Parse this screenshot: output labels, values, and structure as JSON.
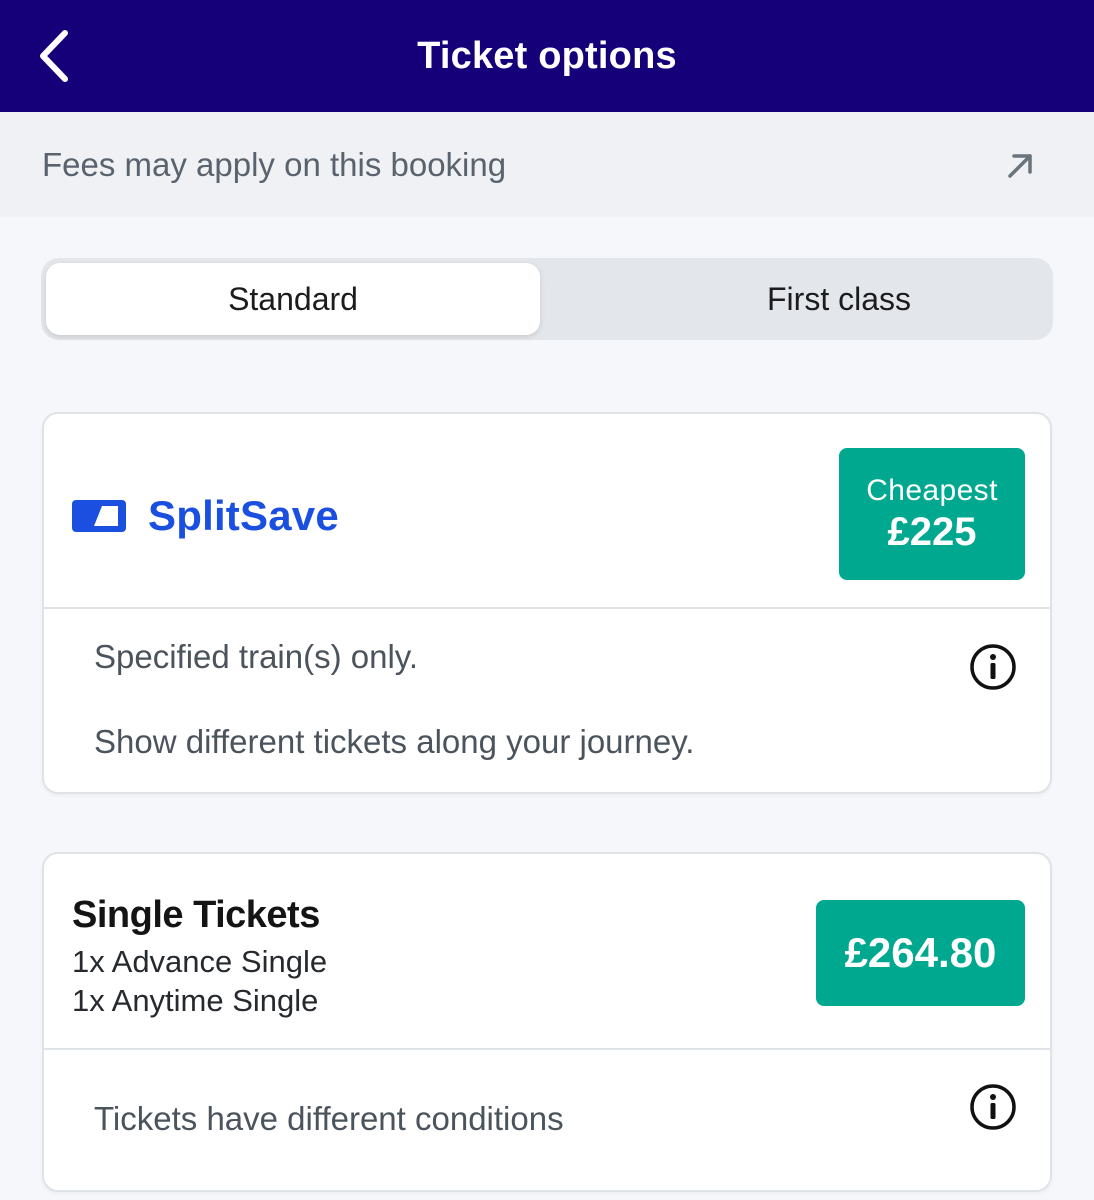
{
  "header": {
    "title": "Ticket options",
    "back_icon": "chevron-left-icon"
  },
  "fees_bar": {
    "text": "Fees may apply on this booking",
    "icon": "arrow-up-right-icon"
  },
  "class_toggle": {
    "options": [
      {
        "label": "Standard",
        "selected": true
      },
      {
        "label": "First class",
        "selected": false
      }
    ]
  },
  "cards": [
    {
      "brand": "SplitSave",
      "badge_label": "Cheapest",
      "price": "£225",
      "lines": [
        "Specified train(s) only.",
        "Show different tickets along your journey."
      ],
      "info_icon": "info-icon"
    },
    {
      "title": "Single Tickets",
      "items": [
        "1x Advance Single",
        "1x Anytime Single"
      ],
      "price": "£264.80",
      "lines": [
        "Tickets have different conditions"
      ],
      "info_icon": "info-icon"
    }
  ],
  "colors": {
    "header_bg": "#15007a",
    "price_badge": "#00a88f",
    "brand_blue": "#1a4fe0"
  }
}
